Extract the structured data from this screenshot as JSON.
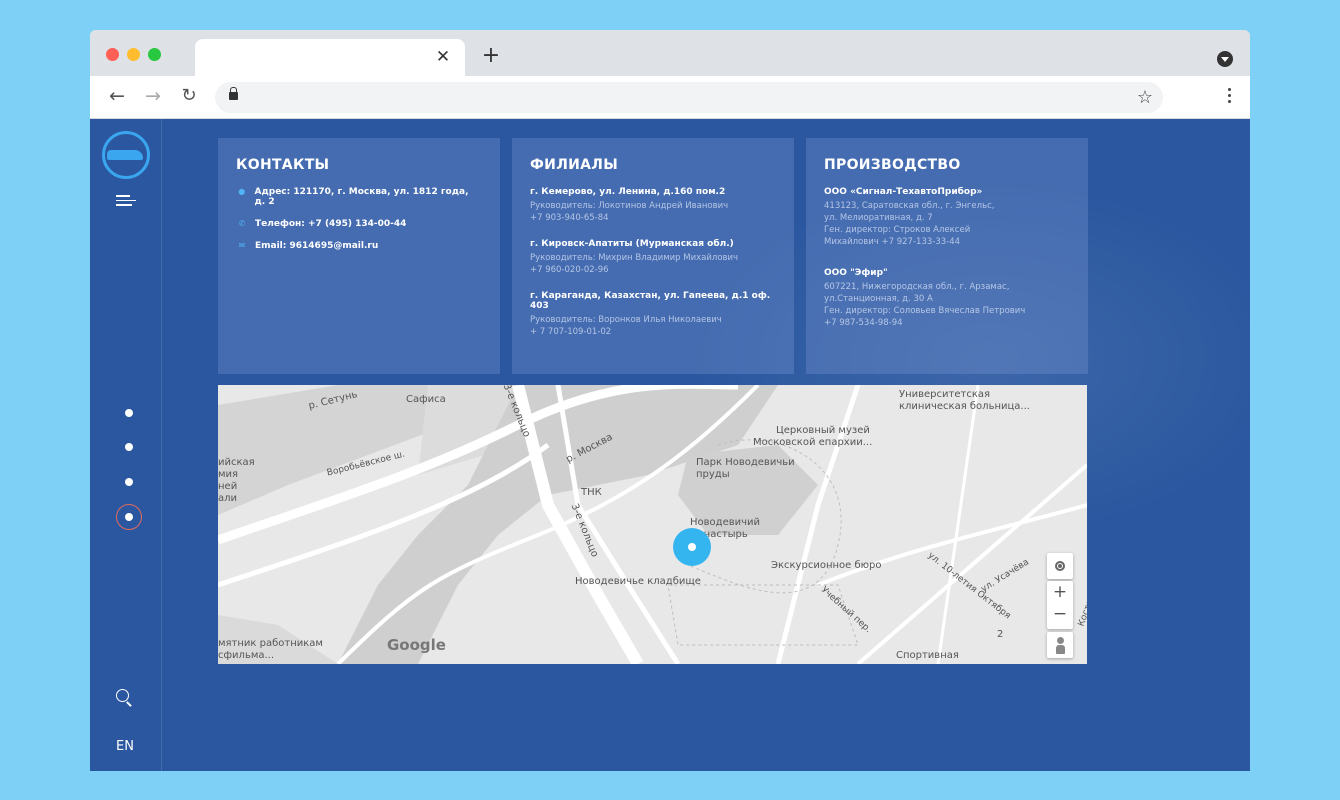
{
  "browser": {
    "tab_close": "✕",
    "new_tab": "+",
    "back": "←",
    "forward": "→",
    "reload": "↻",
    "star": "☆"
  },
  "sidebar": {
    "lang": "EN"
  },
  "contacts": {
    "title": "КОНТАКТЫ",
    "items": [
      {
        "icon": "location-pin-icon",
        "text": "Адрес: 121170, г. Москва, ул. 1812 года, д. 2"
      },
      {
        "icon": "phone-icon",
        "text": "Телефон: +7 (495) 134-00-44"
      },
      {
        "icon": "mail-icon",
        "text": "Email: 9614695@mail.ru"
      }
    ]
  },
  "branches": {
    "title": "ФИЛИАЛЫ",
    "items": [
      {
        "name": "г. Кемерово, ул. Ленина, д.160 пом.2",
        "lines": [
          "Руководитель: Локотинов Андрей Иванович",
          "+7 903-940-65-84"
        ]
      },
      {
        "name": "г. Кировск-Апатиты (Мурманская обл.)",
        "lines": [
          "Руководитель: Михрин Владимир Михайлович",
          "+7 960-020-02-96"
        ]
      },
      {
        "name": "г. Караганда, Казахстан, ул. Гапеева, д.1 оф. 403",
        "lines": [
          "Руководитель: Воронков Илья Николаевич",
          "+ 7 707-109-01-02"
        ]
      }
    ]
  },
  "production": {
    "title": "ПРОИЗВОДСТВО",
    "items": [
      {
        "name": "ООО «Сигнал-ТехавтоПрибор»",
        "lines": [
          "413123, Саратовская обл., г. Энгельс,",
          "ул. Мелиоративная, д. 7",
          "Ген. директор: Строков Алексей",
          "Михайлович +7 927-133-33-44"
        ]
      },
      {
        "name": "ООО \"Эфир\"",
        "lines": [
          "607221, Нижегородская обл., г. Арзамас,",
          "ул.Станционная, д. 30 А",
          "Ген. директор: Соловьев Вячеслав Петрович",
          "+7 987-534-98-94"
        ]
      }
    ]
  },
  "map": {
    "labels": {
      "setun": "р. Сетунь",
      "safisa": "Сафиса",
      "ring1": "3-е кольцо",
      "univ": "Университетская",
      "univ2": "клиническая больница...",
      "moskva": "р. Москва",
      "museum1": "Церковный музей",
      "museum2": "Московской епархии...",
      "vorob": "Воробьёвское ш.",
      "park1": "Парк Новодевичьи",
      "park2": "пруды",
      "left1": "ийская",
      "left2": "мия",
      "left3": "ней",
      "left4": "али",
      "tnk": "ТНК",
      "ring2": "3-е кольцо",
      "monastery1": "Новодевичий",
      "monastery2": "монастырь",
      "excursion": "Экскурсионное бюро",
      "cemetery": "Новодевичье кладбище",
      "oct": "ул. 10-летия Октября",
      "usach": "ул. Усачёва",
      "uchebny": "Учебный пер.",
      "monument1": "мятник работникам",
      "monument2": "сфильма...",
      "sport": "Спортивная",
      "two": "2",
      "kost": "Костом"
    },
    "google": "Google",
    "zoom_in": "+",
    "zoom_out": "−"
  }
}
